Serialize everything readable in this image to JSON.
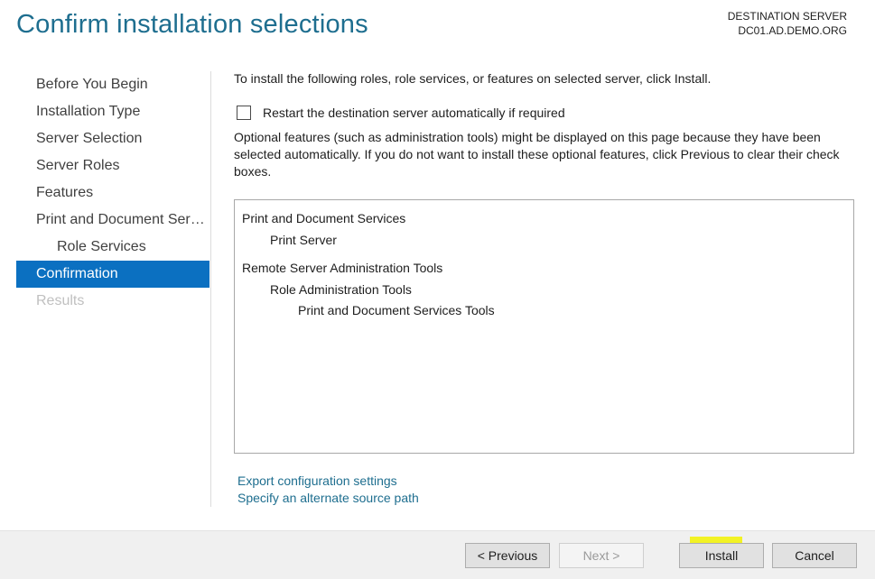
{
  "header": {
    "title": "Confirm installation selections",
    "destination_label": "DESTINATION SERVER",
    "destination_server": "DC01.AD.DEMO.ORG"
  },
  "nav": {
    "items": [
      {
        "label": "Before You Begin",
        "state": "normal"
      },
      {
        "label": "Installation Type",
        "state": "normal"
      },
      {
        "label": "Server Selection",
        "state": "normal"
      },
      {
        "label": "Server Roles",
        "state": "normal"
      },
      {
        "label": "Features",
        "state": "normal"
      },
      {
        "label": "Print and Document Servi...",
        "state": "normal"
      },
      {
        "label": "Role Services",
        "state": "sub"
      },
      {
        "label": "Confirmation",
        "state": "active"
      },
      {
        "label": "Results",
        "state": "disabled"
      }
    ]
  },
  "content": {
    "intro": "To install the following roles, role services, or features on selected server, click Install.",
    "restart_label": "Restart the destination server automatically if required",
    "restart_checked": false,
    "optional_note": "Optional features (such as administration tools) might be displayed on this page because they have been selected automatically. If you do not want to install these optional features, click Previous to clear their check boxes."
  },
  "selections": [
    {
      "label": "Print and Document Services",
      "level": 0
    },
    {
      "label": "Print Server",
      "level": 1
    },
    {
      "label": "Remote Server Administration Tools",
      "level": 0
    },
    {
      "label": "Role Administration Tools",
      "level": 1
    },
    {
      "label": "Print and Document Services Tools",
      "level": 2
    }
  ],
  "links": {
    "export": "Export configuration settings",
    "alternate_source": "Specify an alternate source path"
  },
  "buttons": {
    "previous": "< Previous",
    "next": "Next >",
    "install": "Install",
    "cancel": "Cancel"
  },
  "colors": {
    "accent": "#0b70c1",
    "title": "#1e6e8f",
    "highlight": "#f2f200"
  }
}
